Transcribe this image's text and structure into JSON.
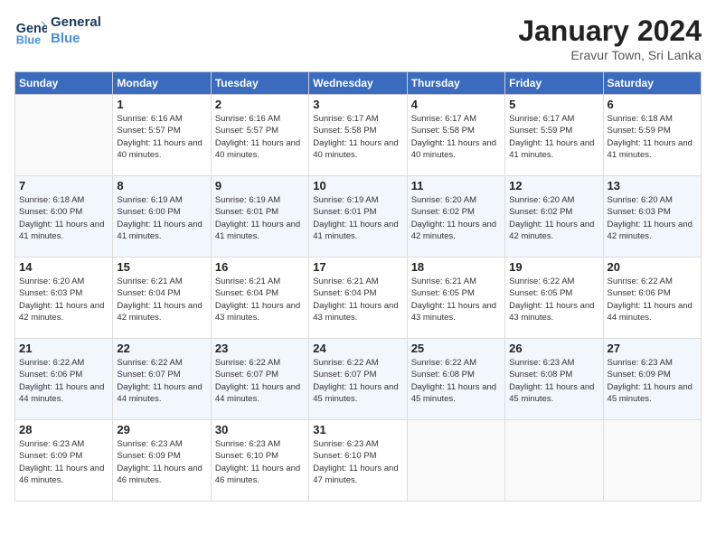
{
  "header": {
    "logo_line1": "General",
    "logo_line2": "Blue",
    "month": "January 2024",
    "location": "Eravur Town, Sri Lanka"
  },
  "weekdays": [
    "Sunday",
    "Monday",
    "Tuesday",
    "Wednesday",
    "Thursday",
    "Friday",
    "Saturday"
  ],
  "weeks": [
    [
      {
        "day": "",
        "empty": true
      },
      {
        "day": "1",
        "sunrise": "6:16 AM",
        "sunset": "5:57 PM",
        "daylight": "11 hours and 40 minutes."
      },
      {
        "day": "2",
        "sunrise": "6:16 AM",
        "sunset": "5:57 PM",
        "daylight": "11 hours and 40 minutes."
      },
      {
        "day": "3",
        "sunrise": "6:17 AM",
        "sunset": "5:58 PM",
        "daylight": "11 hours and 40 minutes."
      },
      {
        "day": "4",
        "sunrise": "6:17 AM",
        "sunset": "5:58 PM",
        "daylight": "11 hours and 40 minutes."
      },
      {
        "day": "5",
        "sunrise": "6:17 AM",
        "sunset": "5:59 PM",
        "daylight": "11 hours and 41 minutes."
      },
      {
        "day": "6",
        "sunrise": "6:18 AM",
        "sunset": "5:59 PM",
        "daylight": "11 hours and 41 minutes."
      }
    ],
    [
      {
        "day": "7",
        "sunrise": "6:18 AM",
        "sunset": "6:00 PM",
        "daylight": "11 hours and 41 minutes."
      },
      {
        "day": "8",
        "sunrise": "6:19 AM",
        "sunset": "6:00 PM",
        "daylight": "11 hours and 41 minutes."
      },
      {
        "day": "9",
        "sunrise": "6:19 AM",
        "sunset": "6:01 PM",
        "daylight": "11 hours and 41 minutes."
      },
      {
        "day": "10",
        "sunrise": "6:19 AM",
        "sunset": "6:01 PM",
        "daylight": "11 hours and 41 minutes."
      },
      {
        "day": "11",
        "sunrise": "6:20 AM",
        "sunset": "6:02 PM",
        "daylight": "11 hours and 42 minutes."
      },
      {
        "day": "12",
        "sunrise": "6:20 AM",
        "sunset": "6:02 PM",
        "daylight": "11 hours and 42 minutes."
      },
      {
        "day": "13",
        "sunrise": "6:20 AM",
        "sunset": "6:03 PM",
        "daylight": "11 hours and 42 minutes."
      }
    ],
    [
      {
        "day": "14",
        "sunrise": "6:20 AM",
        "sunset": "6:03 PM",
        "daylight": "11 hours and 42 minutes."
      },
      {
        "day": "15",
        "sunrise": "6:21 AM",
        "sunset": "6:04 PM",
        "daylight": "11 hours and 42 minutes."
      },
      {
        "day": "16",
        "sunrise": "6:21 AM",
        "sunset": "6:04 PM",
        "daylight": "11 hours and 43 minutes."
      },
      {
        "day": "17",
        "sunrise": "6:21 AM",
        "sunset": "6:04 PM",
        "daylight": "11 hours and 43 minutes."
      },
      {
        "day": "18",
        "sunrise": "6:21 AM",
        "sunset": "6:05 PM",
        "daylight": "11 hours and 43 minutes."
      },
      {
        "day": "19",
        "sunrise": "6:22 AM",
        "sunset": "6:05 PM",
        "daylight": "11 hours and 43 minutes."
      },
      {
        "day": "20",
        "sunrise": "6:22 AM",
        "sunset": "6:06 PM",
        "daylight": "11 hours and 44 minutes."
      }
    ],
    [
      {
        "day": "21",
        "sunrise": "6:22 AM",
        "sunset": "6:06 PM",
        "daylight": "11 hours and 44 minutes."
      },
      {
        "day": "22",
        "sunrise": "6:22 AM",
        "sunset": "6:07 PM",
        "daylight": "11 hours and 44 minutes."
      },
      {
        "day": "23",
        "sunrise": "6:22 AM",
        "sunset": "6:07 PM",
        "daylight": "11 hours and 44 minutes."
      },
      {
        "day": "24",
        "sunrise": "6:22 AM",
        "sunset": "6:07 PM",
        "daylight": "11 hours and 45 minutes."
      },
      {
        "day": "25",
        "sunrise": "6:22 AM",
        "sunset": "6:08 PM",
        "daylight": "11 hours and 45 minutes."
      },
      {
        "day": "26",
        "sunrise": "6:23 AM",
        "sunset": "6:08 PM",
        "daylight": "11 hours and 45 minutes."
      },
      {
        "day": "27",
        "sunrise": "6:23 AM",
        "sunset": "6:09 PM",
        "daylight": "11 hours and 45 minutes."
      }
    ],
    [
      {
        "day": "28",
        "sunrise": "6:23 AM",
        "sunset": "6:09 PM",
        "daylight": "11 hours and 46 minutes."
      },
      {
        "day": "29",
        "sunrise": "6:23 AM",
        "sunset": "6:09 PM",
        "daylight": "11 hours and 46 minutes."
      },
      {
        "day": "30",
        "sunrise": "6:23 AM",
        "sunset": "6:10 PM",
        "daylight": "11 hours and 46 minutes."
      },
      {
        "day": "31",
        "sunrise": "6:23 AM",
        "sunset": "6:10 PM",
        "daylight": "11 hours and 47 minutes."
      },
      {
        "day": "",
        "empty": true
      },
      {
        "day": "",
        "empty": true
      },
      {
        "day": "",
        "empty": true
      }
    ]
  ]
}
